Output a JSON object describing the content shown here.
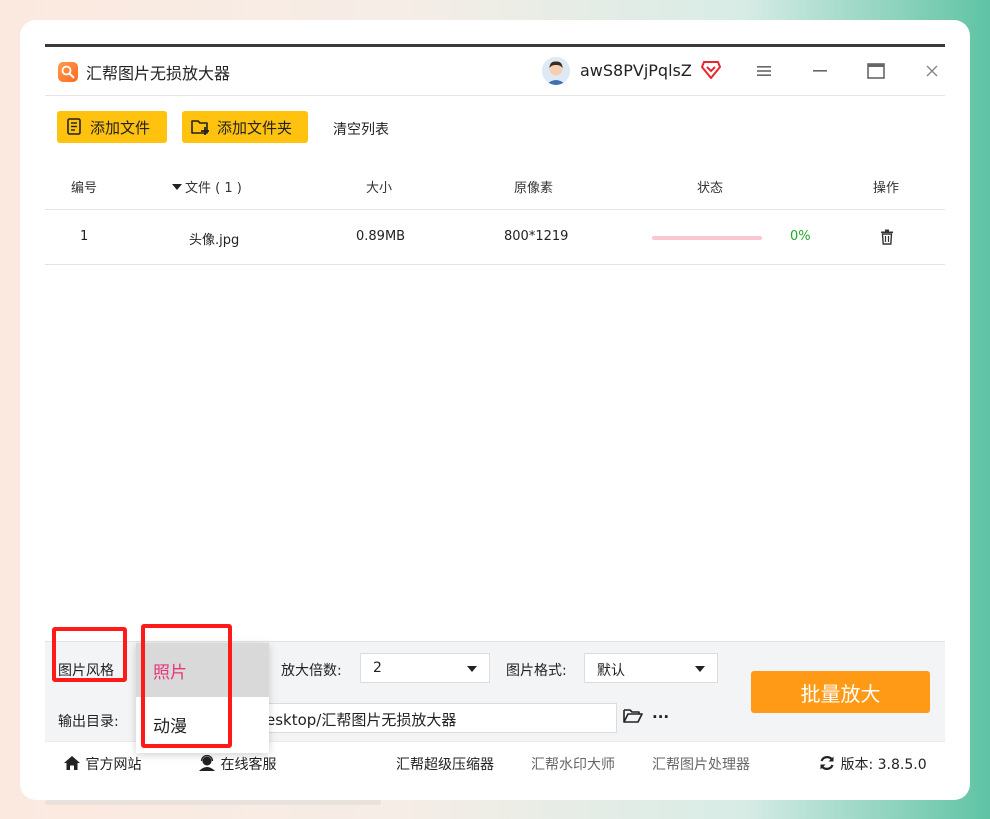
{
  "app": {
    "title": "汇帮图片无损放大器",
    "username": "awS8PVjPqlsZ"
  },
  "toolbar": {
    "add_file": "添加文件",
    "add_folder": "添加文件夹",
    "clear_list": "清空列表"
  },
  "table": {
    "headers": {
      "index": "编号",
      "file": "文件 ( 1 )",
      "size": "大小",
      "pixels": "原像素",
      "status": "状态",
      "action": "操作"
    },
    "rows": [
      {
        "index": "1",
        "file": "头像.jpg",
        "size": "0.89MB",
        "pixels": "800*1219",
        "progress": 0,
        "percent": "0%"
      }
    ]
  },
  "settings": {
    "style_label": "图片风格",
    "style_options": [
      "照片",
      "动漫"
    ],
    "style_selected": "照片",
    "scale_label": "放大倍数:",
    "scale_value": "2",
    "format_label": "图片格式:",
    "format_value": "默认",
    "output_label": "输出目录:",
    "output_path": "esktop/汇帮图片无损放大器",
    "more": "···",
    "batch_button": "批量放大"
  },
  "footer": {
    "website": "官方网站",
    "support": "在线客服",
    "link1": "汇帮超级压缩器",
    "link2": "汇帮水印大师",
    "link3": "汇帮图片处理器",
    "version": "版本: 3.8.5.0"
  },
  "colors": {
    "accent_yellow": "#ffc20e",
    "batch_orange": "#ff9a16",
    "highlight_red": "#ff1a1a",
    "selected_pink": "#e8367a",
    "progress_pink": "#f9c6d2",
    "percent_green": "#25a425"
  }
}
